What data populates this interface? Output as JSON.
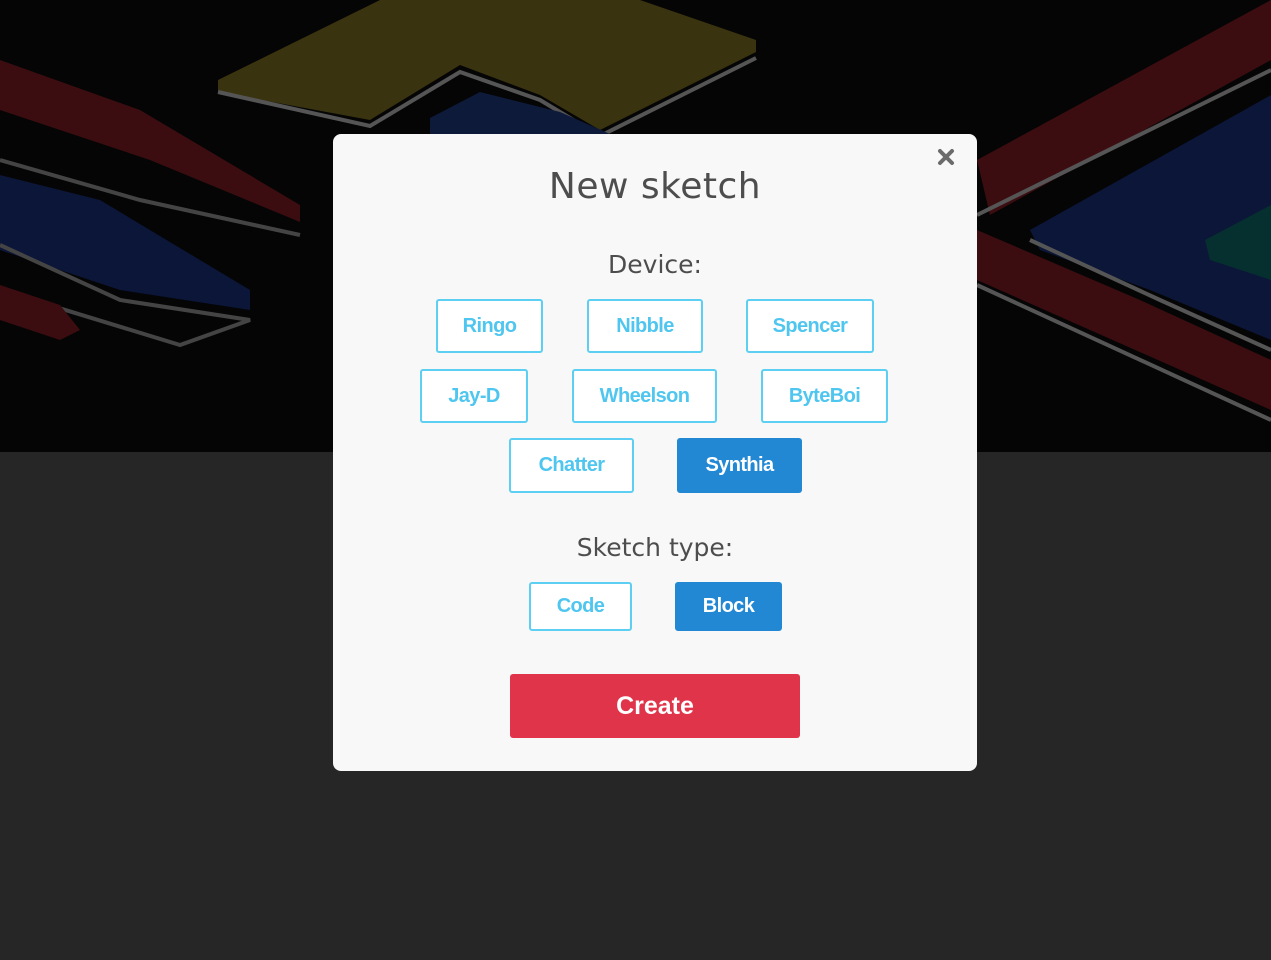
{
  "modal": {
    "title": "New sketch",
    "close_icon": "close-icon",
    "device_label": "Device:",
    "devices": [
      {
        "label": "Ringo",
        "selected": false
      },
      {
        "label": "Nibble",
        "selected": false
      },
      {
        "label": "Spencer",
        "selected": false
      },
      {
        "label": "Jay-D",
        "selected": false
      },
      {
        "label": "Wheelson",
        "selected": false
      },
      {
        "label": "ByteBoi",
        "selected": false
      },
      {
        "label": "Chatter",
        "selected": false
      },
      {
        "label": "Synthia",
        "selected": true
      }
    ],
    "sketch_type_label": "Sketch type:",
    "sketch_types": [
      {
        "label": "Code",
        "selected": false
      },
      {
        "label": "Block",
        "selected": true
      }
    ],
    "create_label": "Create"
  },
  "colors": {
    "accent": "#5ccff2",
    "selected": "#2288d4",
    "create": "#e0344a"
  }
}
